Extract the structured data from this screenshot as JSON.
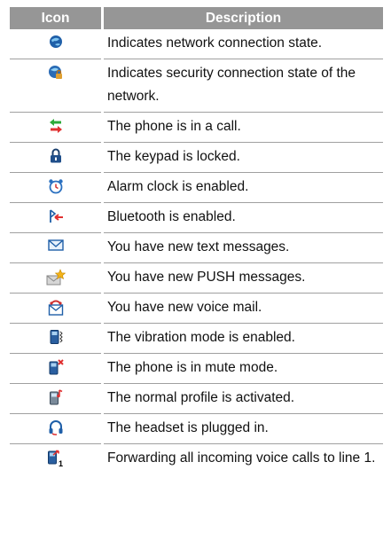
{
  "table": {
    "header_icon": "Icon",
    "header_description": "Description",
    "rows": [
      {
        "icon": "network-globe-icon",
        "description": "Indicates network connection state."
      },
      {
        "icon": "security-lock-globe-icon",
        "description": "Indicates security connection state of the network."
      },
      {
        "icon": "call-arrows-icon",
        "description": "The phone is in a call."
      },
      {
        "icon": "padlock-icon",
        "description": "The keypad is locked."
      },
      {
        "icon": "alarm-clock-icon",
        "description": "Alarm clock is enabled."
      },
      {
        "icon": "bluetooth-icon",
        "description": "Bluetooth is enabled."
      },
      {
        "icon": "envelope-icon",
        "description": "You have new text messages."
      },
      {
        "icon": "push-message-star-icon",
        "description": "You have new PUSH messages."
      },
      {
        "icon": "voice-mail-icon",
        "description": "You have new voice mail."
      },
      {
        "icon": "vibration-phone-icon",
        "description": "The vibration mode is enabled."
      },
      {
        "icon": "mute-phone-icon",
        "description": "The phone is in mute mode."
      },
      {
        "icon": "normal-profile-phone-icon",
        "description": "The normal profile is activated."
      },
      {
        "icon": "headset-icon",
        "description": "The headset is plugged in."
      },
      {
        "icon": "forward-line1-icon",
        "description": "Forwarding all incoming voice calls to line 1."
      }
    ]
  }
}
